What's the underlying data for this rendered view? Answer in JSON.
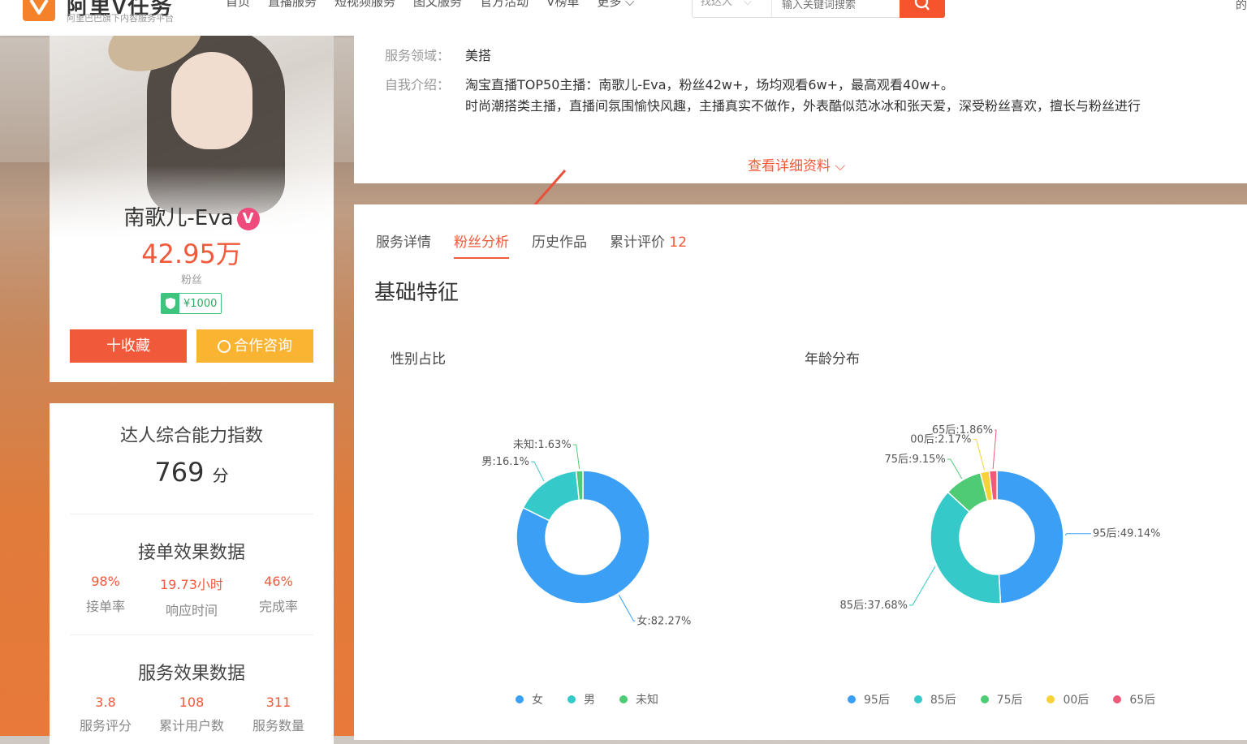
{
  "nav": {
    "logo_text": "阿里V任务",
    "logo_sub": "阿里巴巴旗下内容服务平台",
    "items": [
      "首页",
      "直播服务",
      "短视频服务",
      "图文服务",
      "官方活动",
      "V榜单",
      "更多"
    ],
    "search_type": "找达人",
    "search_placeholder": "输入关键词搜索",
    "right_char": "的"
  },
  "profile": {
    "name": "南歌儿-Eva",
    "verified_badge": "V",
    "fans": "42.95万",
    "fans_label": "粉丝",
    "price": "¥1000",
    "fav_button": "十收藏",
    "consult_button": "合作咨询"
  },
  "score": {
    "title": "达人综合能力指数",
    "value": "769",
    "unit": "分",
    "order_title": "接单效果数据",
    "order_stats": [
      {
        "value": "98%",
        "label": "接单率"
      },
      {
        "value": "19.73小时",
        "label": "响应时间"
      },
      {
        "value": "46%",
        "label": "完成率"
      }
    ],
    "service_title": "服务效果数据",
    "service_stats": [
      {
        "value": "3.8",
        "label": "服务评分"
      },
      {
        "value": "108",
        "label": "累计用户数"
      },
      {
        "value": "311",
        "label": "服务数量"
      }
    ]
  },
  "info": {
    "domain_label": "服务领域：",
    "domain_value": "美搭",
    "intro_label": "自我介绍：",
    "intro_line1": "淘宝直播TOP50主播：南歌儿-Eva，粉丝42w+，场均观看6w+，最高观看40w+。",
    "intro_line2": "时尚潮搭类主播，直播间氛围愉快风趣，主播真实不做作，外表酷似范冰冰和张天爱，深受粉丝喜欢，擅长与粉丝进行",
    "more_link": "查看详细资料"
  },
  "tabs": [
    {
      "label": "服务详情",
      "active": false
    },
    {
      "label": "粉丝分析",
      "active": true
    },
    {
      "label": "历史作品",
      "active": false
    },
    {
      "label": "累计评价",
      "count": "12",
      "active": false
    }
  ],
  "section_title": "基础特征",
  "chart_data": [
    {
      "type": "pie",
      "title": "性别占比",
      "series": [
        {
          "name": "女",
          "value": 82.27,
          "label": "女:82.27%",
          "color": "#3a9ff5"
        },
        {
          "name": "男",
          "value": 16.1,
          "label": "男:16.1%",
          "color": "#35c9c9"
        },
        {
          "name": "未知",
          "value": 1.63,
          "label": "未知:1.63%",
          "color": "#4fcb76"
        }
      ],
      "legend": [
        "女",
        "男",
        "未知"
      ],
      "legend_position": "bottom"
    },
    {
      "type": "pie",
      "title": "年龄分布",
      "series": [
        {
          "name": "95后",
          "value": 49.14,
          "label": "95后:49.14%",
          "color": "#3a9ff5"
        },
        {
          "name": "85后",
          "value": 37.68,
          "label": "85后:37.68%",
          "color": "#35c9c9"
        },
        {
          "name": "75后",
          "value": 9.15,
          "label": "75后:9.15%",
          "color": "#4fcb76"
        },
        {
          "name": "00后",
          "value": 2.17,
          "label": "00后:2.17%",
          "color": "#f7d137"
        },
        {
          "name": "65后",
          "value": 1.86,
          "label": "65后:1.86%",
          "color": "#ee5a78"
        }
      ],
      "legend": [
        "95后",
        "85后",
        "75后",
        "00后",
        "65后"
      ],
      "legend_position": "bottom"
    }
  ]
}
